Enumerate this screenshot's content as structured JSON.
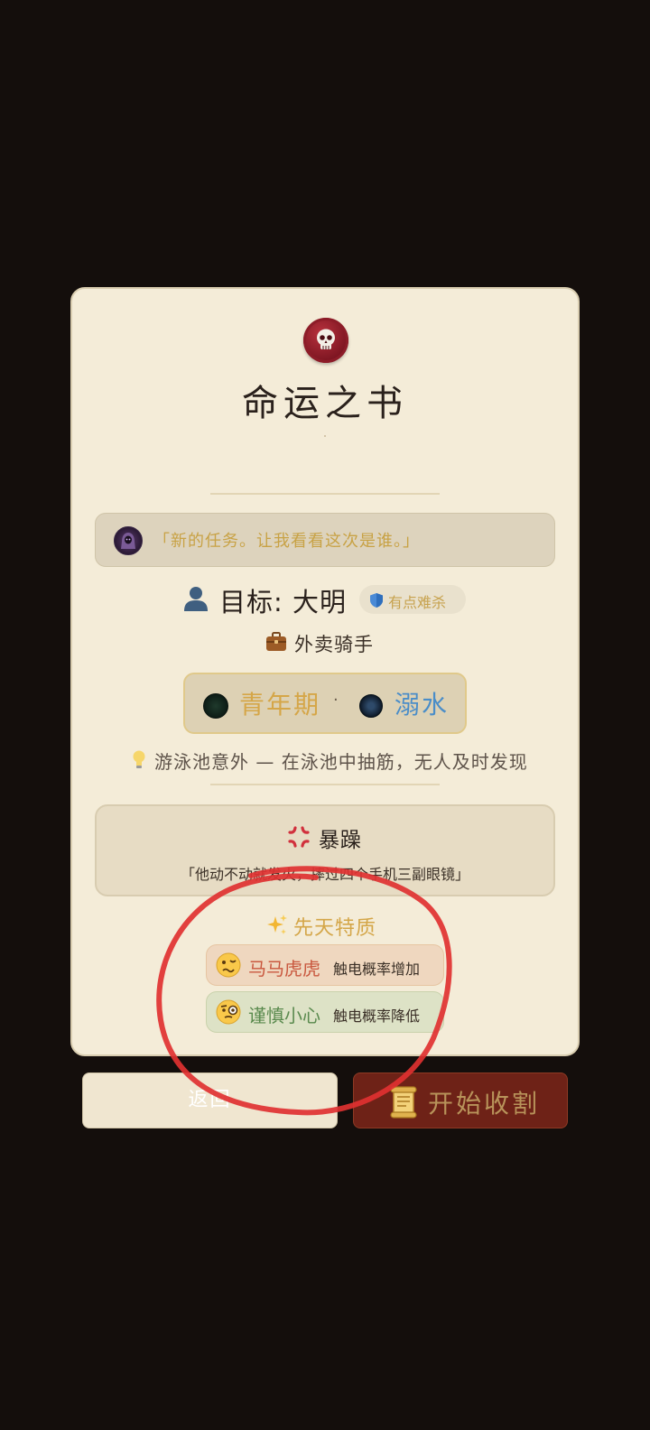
{
  "card": {
    "title": "命运之书",
    "reaper_quote": "「新的任务。让我看看这次是谁。」",
    "target_label": "目标: 大明",
    "difficulty_badge": "有点难杀",
    "occupation": "外卖骑手",
    "life_stage": "青年期",
    "separator": "·",
    "death_type": "溺水",
    "death_cause": "游泳池意外 — 在泳池中抽筋，无人及时发现",
    "personality": {
      "name": "暴躁",
      "description": "「他动不动就发火，摔过四个手机三副眼镜」"
    },
    "innate_title": "先天特质",
    "traits": [
      {
        "name": "马马虎虎",
        "effect": "触电概率增加",
        "tone": "negative",
        "icon": "woozy-face-icon"
      },
      {
        "name": "谨慎小心",
        "effect": "触电概率降低",
        "tone": "positive",
        "icon": "monocle-face-icon"
      }
    ]
  },
  "buttons": {
    "back": "返回",
    "start": "开始收割"
  },
  "colors": {
    "background": "#140e0c",
    "card": "#f4ecd8",
    "gold": "#d5a648",
    "blue": "#4a8dc8",
    "seal_red": "#7c1521",
    "start_button": "#6e2217",
    "annotation_red": "#e03131"
  },
  "icons": [
    "skull-seal-icon",
    "reaper-avatar-icon",
    "person-icon",
    "shield-icon",
    "briefcase-icon",
    "bulb-icon",
    "anger-icon",
    "sparkles-icon",
    "scroll-icon"
  ]
}
